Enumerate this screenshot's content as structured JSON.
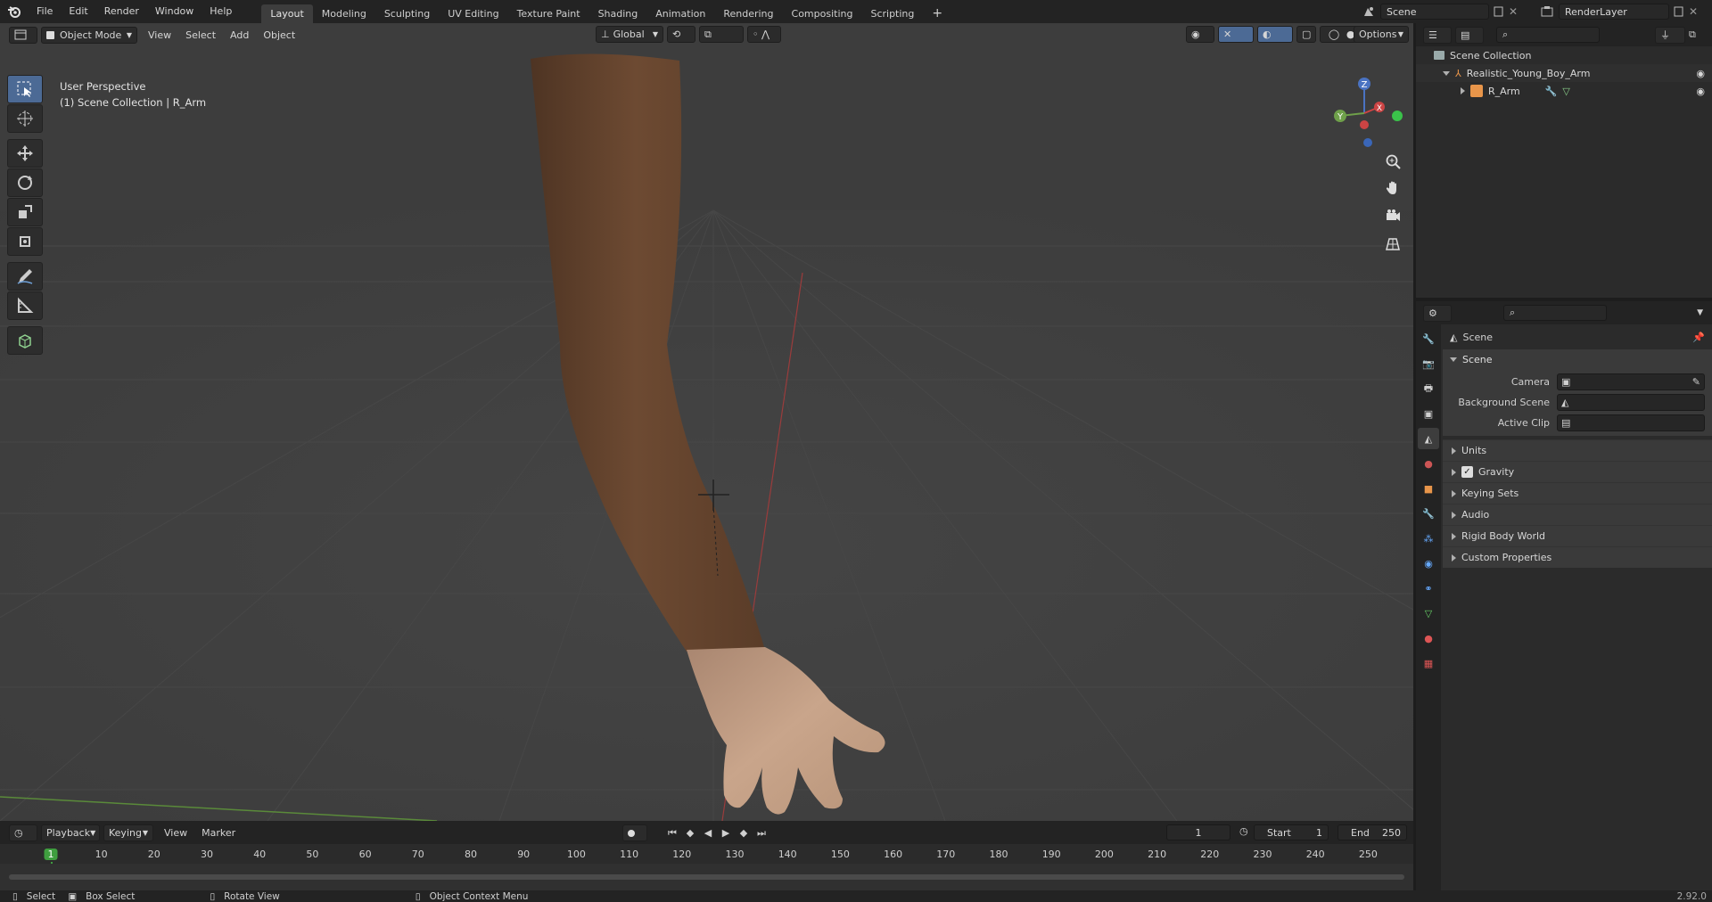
{
  "app": {
    "menus": [
      "File",
      "Edit",
      "Render",
      "Window",
      "Help"
    ],
    "workspaces": [
      "Layout",
      "Modeling",
      "Sculpting",
      "UV Editing",
      "Texture Paint",
      "Shading",
      "Animation",
      "Rendering",
      "Compositing",
      "Scripting"
    ],
    "active_workspace": "Layout",
    "add_workspace": "+",
    "scene_name": "Scene",
    "view_layer": "RenderLayer",
    "version": "2.92.0"
  },
  "viewport": {
    "mode": "Object Mode",
    "menus": [
      "View",
      "Select",
      "Add",
      "Object"
    ],
    "transform_orientation": "Global",
    "options_label": "Options",
    "info_line1": "User Perspective",
    "info_line2": "(1) Scene Collection | R_Arm",
    "gizmo": {
      "z": "Z",
      "y": "Y",
      "x": "X"
    }
  },
  "timeline": {
    "menus": [
      "Playback",
      "Keying",
      "View",
      "Marker"
    ],
    "current_frame": "1",
    "start_label": "Start",
    "start": "1",
    "end_label": "End",
    "end": "250",
    "ticks": [
      "1",
      "10",
      "20",
      "30",
      "40",
      "50",
      "60",
      "70",
      "80",
      "90",
      "100",
      "110",
      "120",
      "130",
      "140",
      "150",
      "160",
      "170",
      "180",
      "190",
      "200",
      "210",
      "220",
      "230",
      "240",
      "250"
    ]
  },
  "statusbar": {
    "select": "Select",
    "box_select": "Box Select",
    "rotate_view": "Rotate View",
    "context_menu": "Object Context Menu"
  },
  "outliner": {
    "root": "Scene Collection",
    "items": [
      {
        "name": "Realistic_Young_Boy_Arm"
      },
      {
        "name": "R_Arm"
      }
    ]
  },
  "properties": {
    "context": "Scene",
    "panel_title": "Scene",
    "fields": [
      {
        "label": "Camera",
        "value": ""
      },
      {
        "label": "Background Scene",
        "value": ""
      },
      {
        "label": "Active Clip",
        "value": ""
      }
    ],
    "subpanels": [
      "Units",
      "Gravity",
      "Keying Sets",
      "Audio",
      "Rigid Body World",
      "Custom Properties"
    ],
    "gravity_enabled": true
  },
  "colors": {
    "accent_blue": "#4c6a95",
    "frame_green": "#3f9e3f",
    "arm_skin": "#6d4a32",
    "hand_skin": "#c9a58b"
  }
}
